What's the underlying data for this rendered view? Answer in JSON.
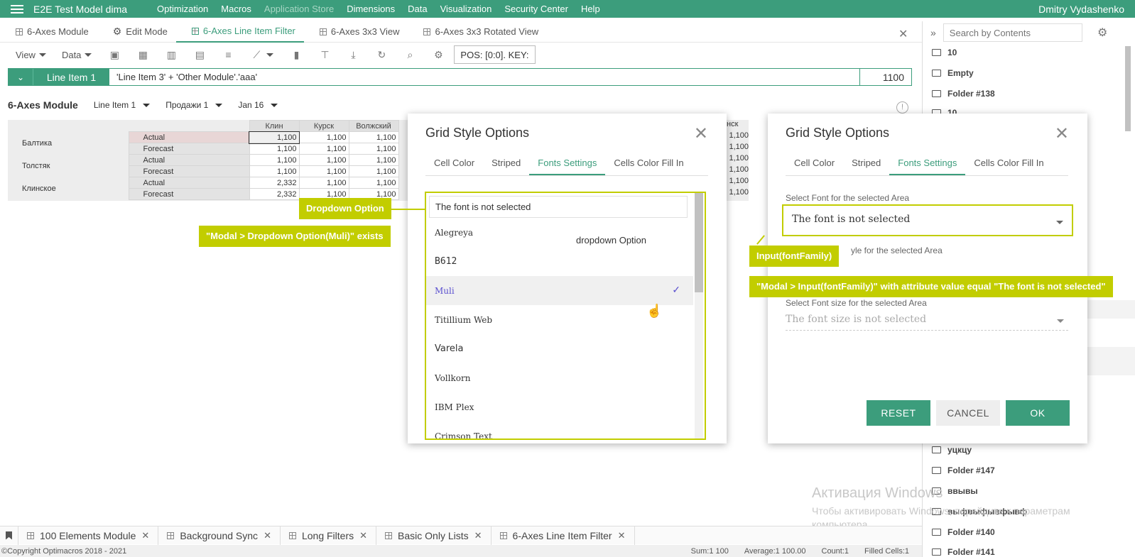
{
  "topbar": {
    "app_title": "E2E Test Model dima",
    "nav": [
      {
        "label": "Optimization",
        "disabled": false
      },
      {
        "label": "Macros",
        "disabled": false
      },
      {
        "label": "Application Store",
        "disabled": true
      },
      {
        "label": "Dimensions",
        "disabled": false
      },
      {
        "label": "Data",
        "disabled": false
      },
      {
        "label": "Visualization",
        "disabled": false
      },
      {
        "label": "Security Center",
        "disabled": false
      },
      {
        "label": "Help",
        "disabled": false
      }
    ],
    "user": "Dmitry Vydashenko"
  },
  "tabs": [
    {
      "label": "6-Axes Module",
      "icon": "grid-icon",
      "active": false
    },
    {
      "label": "Edit Mode",
      "icon": "gear-icon",
      "active": false
    },
    {
      "label": "6-Axes Line Item Filter",
      "icon": "grid-icon",
      "active": true
    },
    {
      "label": "6-Axes 3x3 View",
      "icon": "grid-icon",
      "active": false
    },
    {
      "label": "6-Axes 3x3 Rotated View",
      "icon": "grid-icon",
      "active": false
    }
  ],
  "toolbar": {
    "view_label": "View",
    "data_label": "Data",
    "pos_text": "POS: [0:0]. KEY:"
  },
  "formula": {
    "name": "Line Item 1",
    "expression": "'Line Item 3' + 'Other Module'.'aaa'",
    "value": "1100"
  },
  "module": {
    "title": "6-Axes Module",
    "filters": [
      "Line Item 1",
      "Продажи 1",
      "Jan 16"
    ]
  },
  "grid": {
    "columns": [
      "Клин",
      "Курск",
      "Волжский"
    ],
    "right_header": "нск",
    "rows": [
      {
        "group": "Балтика",
        "type": "Actual",
        "values": [
          "1,100",
          "1,100",
          "1,100"
        ],
        "right": "1,100"
      },
      {
        "group": "",
        "type": "Forecast",
        "values": [
          "1,100",
          "1,100",
          "1,100"
        ],
        "right": "1,100"
      },
      {
        "group": "Толстяк",
        "type": "Actual",
        "values": [
          "1,100",
          "1,100",
          "1,100"
        ],
        "right": "1,100"
      },
      {
        "group": "",
        "type": "Forecast",
        "values": [
          "1,100",
          "1,100",
          "1,100"
        ],
        "right": "1,100"
      },
      {
        "group": "Клинское",
        "type": "Actual",
        "values": [
          "2,332",
          "1,100",
          "1,100"
        ],
        "right": "1,100"
      },
      {
        "group": "",
        "type": "Forecast",
        "values": [
          "2,332",
          "1,100",
          "1,100"
        ],
        "right": "1,100"
      }
    ]
  },
  "modal1": {
    "title": "Grid Style Options",
    "tabs": [
      "Cell Color",
      "Striped",
      "Fonts Settings",
      "Cells Color Fill In"
    ],
    "active_tab": 2,
    "input_text": "The font is not selected",
    "options": [
      {
        "label": "Alegreya",
        "style": "serif",
        "selected": false
      },
      {
        "label": "B612",
        "style": "mono",
        "selected": false
      },
      {
        "label": "Muli",
        "style": "serif",
        "selected": true
      },
      {
        "label": "Titillium Web",
        "style": "serif",
        "selected": false
      },
      {
        "label": "Varela",
        "style": "sans",
        "selected": false
      },
      {
        "label": "Vollkorn",
        "style": "serif",
        "selected": false
      },
      {
        "label": "IBM Plex",
        "style": "serif",
        "selected": false
      },
      {
        "label": "Crimson Text",
        "style": "serif",
        "selected": false
      }
    ],
    "side_text": "dropdown Option"
  },
  "modal2": {
    "title": "Grid Style Options",
    "tabs": [
      "Cell Color",
      "Striped",
      "Fonts Settings",
      "Cells Color Fill In"
    ],
    "font_label": "Select Font for the selected Area",
    "font_value": "The font is not selected",
    "style_label": "yle for the selected Area",
    "size_label": "Select Font size for the selected Area",
    "size_value": "The font size is not selected",
    "reset": "RESET",
    "cancel": "CANCEL",
    "ok": "OK"
  },
  "annotations": {
    "dropdown_option": "Dropdown Option",
    "modal_dropdown": "\"Modal > Dropdown Option(Muli)\" exists",
    "input_font": "Input(fontFamily)",
    "modal_input": "\"Modal > Input(fontFamily)\" with attribute value equal \"The font is not selected\""
  },
  "right_panel": {
    "search_placeholder": "Search by Contents",
    "folders_top": [
      "10",
      "Empty",
      "Folder #138",
      "10"
    ],
    "folders_bottom": [
      "уцкцу",
      "Folder #147",
      "ввывы",
      "выфвыфывфывф",
      "Folder #140",
      "Folder #141"
    ]
  },
  "watermark": {
    "line1": "Активация Windows",
    "line2": "Чтобы активировать Windows, перейдите к параметрам",
    "line3": "компьютера."
  },
  "bottom_tabs": [
    "100 Elements Module",
    "Background Sync",
    "Long Filters",
    "Basic Only Lists",
    "6-Axes Line Item Filter"
  ],
  "status": {
    "copyright": "©Copyright Optimacros 2018 - 2021",
    "sum": "Sum:1 100",
    "average": "Average:1 100.00",
    "count": "Count:1",
    "filled": "Filled Cells:1"
  },
  "colors": {
    "accent": "#3c9d7c",
    "annotation": "#c2cd00",
    "selected_option": "#5a4fcf"
  }
}
